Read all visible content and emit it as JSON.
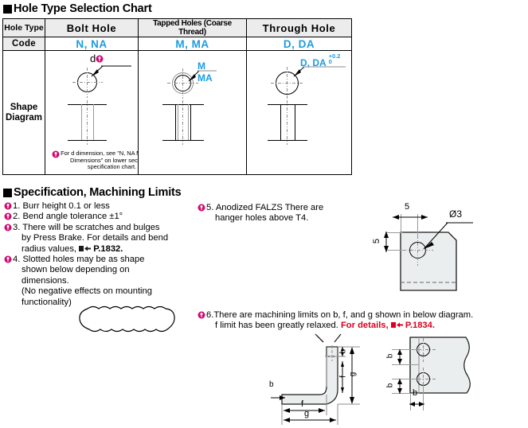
{
  "section1": {
    "title": "Hole Type Selection Chart",
    "table": {
      "header": [
        "Hole Type",
        "Bolt Hole",
        "Tapped Holes (Coarse Thread)",
        "Through Hole"
      ],
      "code_label": "Code",
      "codes": [
        "N, NA",
        "M, MA",
        "D, DA"
      ],
      "shape_label_line1": "Shape",
      "shape_label_line2": "Diagram",
      "code_color": "#1b9ce3",
      "bolt_callout": "d",
      "tapped_callout_top": "M",
      "tapped_callout_bottom": "MA",
      "through_callout": "D, DA",
      "through_tol_upper": "+0.2",
      "through_tol_lower": "0",
      "note": "For d dimension, see \"N, NA Machining Dimensions\" on lower section of specification chart."
    }
  },
  "section2": {
    "title": "Specification, Machining Limits",
    "items_left": [
      {
        "num": "1.",
        "text": "Burr height 0.1 or less"
      },
      {
        "num": "2.",
        "text": "Bend angle tolerance ±1°"
      },
      {
        "num": "3.",
        "line1": "There will be scratches and bulges",
        "line2": "by Press Brake. For details and bend",
        "line3_pre": "radius values,",
        "page": "P.1832."
      },
      {
        "num": "4.",
        "line1": "Slotted holes may be as shape",
        "line2": "shown below depending on",
        "line3": "dimensions.",
        "line4": "(No negative effects on mounting",
        "line5": "functionality)"
      }
    ],
    "items_right": [
      {
        "num": "5.",
        "line1": "Anodized FALZS There are",
        "line2": "hanger holes above T4."
      },
      {
        "num": "6.",
        "line1": "There are machining limits on b, f, and g shown in below diagram.",
        "line2_pre": "f limit has been greatly relaxed.",
        "line2_red": "For details,",
        "page": "P.1834."
      }
    ],
    "hanger_drawing": {
      "dim_top": "5",
      "dim_left": "5",
      "hole_label": "Ø3"
    },
    "limits_drawing": {
      "bracket_labels": [
        "b",
        "g",
        "f",
        "b",
        "g"
      ],
      "plate_labels": [
        "b",
        "b",
        "b"
      ]
    },
    "red_color": "#d8001e"
  }
}
